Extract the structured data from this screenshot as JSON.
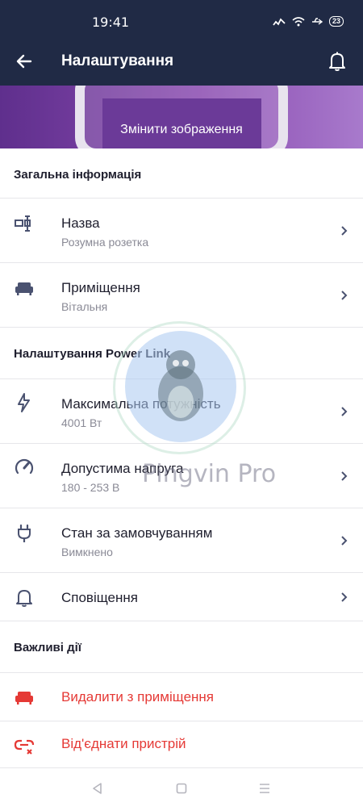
{
  "status_bar": {
    "time": "19:41",
    "battery": "23"
  },
  "app_bar": {
    "title": "Налаштування",
    "back_icon": "arrow-left-icon",
    "bell_icon": "bell-icon"
  },
  "banner": {
    "button_label": "Змінити зображення"
  },
  "sections": {
    "general": {
      "header": "Загальна інформація",
      "name": {
        "title": "Назва",
        "value": "Розумна розетка"
      },
      "room": {
        "title": "Приміщення",
        "value": "Вітальня"
      }
    },
    "power_link": {
      "header": "Налаштування Power Link",
      "max_power": {
        "title": "Максимальна потужність",
        "value": "4001 Вт"
      },
      "voltage": {
        "title": "Допустима напруга",
        "value": "180 - 253 В"
      },
      "default_state": {
        "title": "Стан за замовчуванням",
        "value": "Вимкнено"
      },
      "notifications": {
        "title": "Сповіщення"
      }
    },
    "important": {
      "header": "Важливі дії",
      "remove": {
        "title": "Видалити з приміщення"
      },
      "unpair": {
        "title": "Від'єднати пристрій"
      }
    }
  },
  "watermark": {
    "text": "Pingvin Pro"
  },
  "colors": {
    "primary": "#202a45",
    "danger": "#e53935",
    "icon": "#4a5270",
    "accent": "#7b3fa6"
  }
}
